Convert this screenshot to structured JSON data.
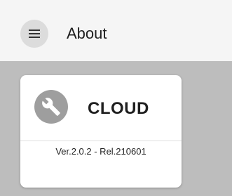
{
  "app_bar": {
    "title": "About",
    "menu_icon": "hamburger-menu-icon"
  },
  "card": {
    "icon": "wrench-icon",
    "title": "CLOUD",
    "version": "Ver.2.0.2 - Rel.210601"
  },
  "colors": {
    "app_bar_bg": "#f5f5f5",
    "content_bg": "#bdbdbd",
    "card_bg": "#ffffff",
    "icon_circle": "#9e9e9e",
    "menu_circle": "#dcdcdc"
  }
}
